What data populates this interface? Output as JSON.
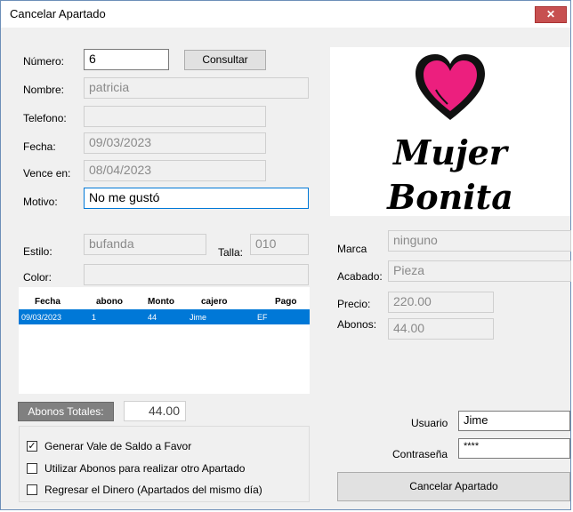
{
  "window": {
    "title": "Cancelar Apartado",
    "close_glyph": "✕"
  },
  "form": {
    "numero_label": "Número:",
    "numero_value": "6",
    "consultar_label": "Consultar",
    "nombre_label": "Nombre:",
    "nombre_value": "patricia",
    "telefono_label": "Telefono:",
    "telefono_value": "",
    "fecha_label": "Fecha:",
    "fecha_value": "09/03/2023",
    "vence_label": "Vence en:",
    "vence_value": "08/04/2023",
    "motivo_label": "Motivo:",
    "motivo_value": "No me gustó",
    "estilo_label": "Estilo:",
    "estilo_value": "bufanda",
    "talla_label": "Talla:",
    "talla_value": "010",
    "color_label": "Color:",
    "color_value": ""
  },
  "logo": {
    "line1": "Mujer",
    "line2": "Bonita",
    "heart_color": "#ec1f7e"
  },
  "product": {
    "marca_label": "Marca",
    "marca_value": "ninguno",
    "acabado_label": "Acabado:",
    "acabado_value": "Pieza",
    "precio_label": "Precio:",
    "precio_value": "220.00",
    "abonos_label": "Abonos:",
    "abonos_value": "44.00"
  },
  "grid": {
    "columns": [
      "Fecha",
      "abono",
      "Monto",
      "cajero",
      "Pago"
    ],
    "rows": [
      [
        "09/03/2023",
        "1",
        "44",
        "Jime",
        "EF"
      ]
    ],
    "selected_color": "#0078d7"
  },
  "totals": {
    "label": "Abonos Totales:",
    "value": "44.00"
  },
  "options": [
    {
      "label": "Generar Vale de Saldo a Favor",
      "checked": true
    },
    {
      "label": "Utilizar Abonos para realizar otro Apartado",
      "checked": false
    },
    {
      "label": "Regresar el Dinero (Apartados del mismo día)",
      "checked": false
    }
  ],
  "auth": {
    "usuario_label": "Usuario",
    "usuario_value": "Jime",
    "contrasena_label": "Contraseña",
    "contrasena_value": "****"
  },
  "actions": {
    "cancelar_label": "Cancelar Apartado"
  }
}
